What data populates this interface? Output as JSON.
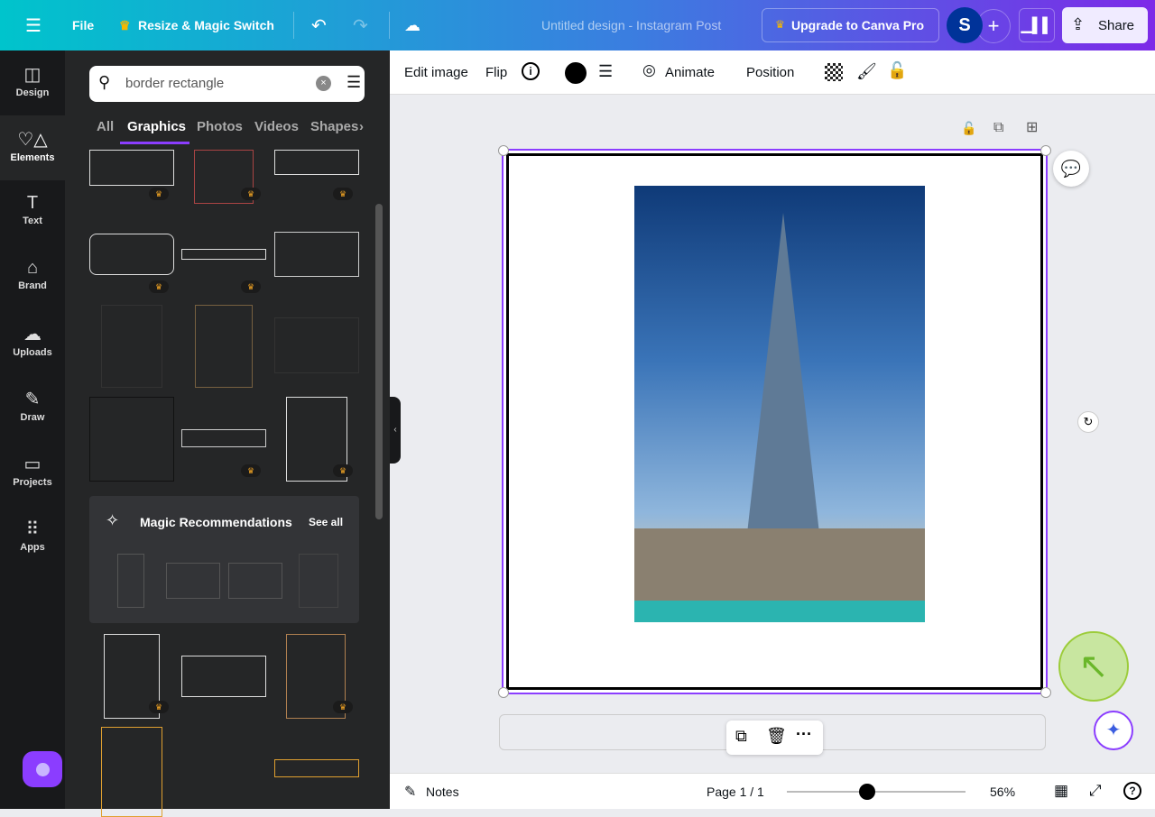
{
  "topbar": {
    "file": "File",
    "resize": "Resize & Magic Switch",
    "title": "Untitled design - Instagram Post",
    "upgrade": "Upgrade to Canva Pro",
    "avatar": "S",
    "share": "Share"
  },
  "rail": [
    {
      "label": "Design",
      "icon": "design-icon"
    },
    {
      "label": "Elements",
      "icon": "elements-icon"
    },
    {
      "label": "Text",
      "icon": "text-icon"
    },
    {
      "label": "Brand",
      "icon": "brand-icon"
    },
    {
      "label": "Uploads",
      "icon": "uploads-icon"
    },
    {
      "label": "Draw",
      "icon": "draw-icon"
    },
    {
      "label": "Projects",
      "icon": "folder-icon"
    },
    {
      "label": "Apps",
      "icon": "apps-icon"
    }
  ],
  "search": {
    "value": "border rectangle"
  },
  "tabs": [
    "All",
    "Graphics",
    "Photos",
    "Videos",
    "Shapes"
  ],
  "magic": {
    "title": "Magic Recommendations",
    "see_all": "See all"
  },
  "toolbar": {
    "edit_image": "Edit image",
    "flip": "Flip",
    "animate": "Animate",
    "position": "Position"
  },
  "bottom": {
    "notes": "Notes",
    "page": "Page 1 / 1",
    "zoom": "56%",
    "zoom_fraction": 0.45
  },
  "colors": {
    "accent": "#8b3dff",
    "fill": "#000000"
  }
}
